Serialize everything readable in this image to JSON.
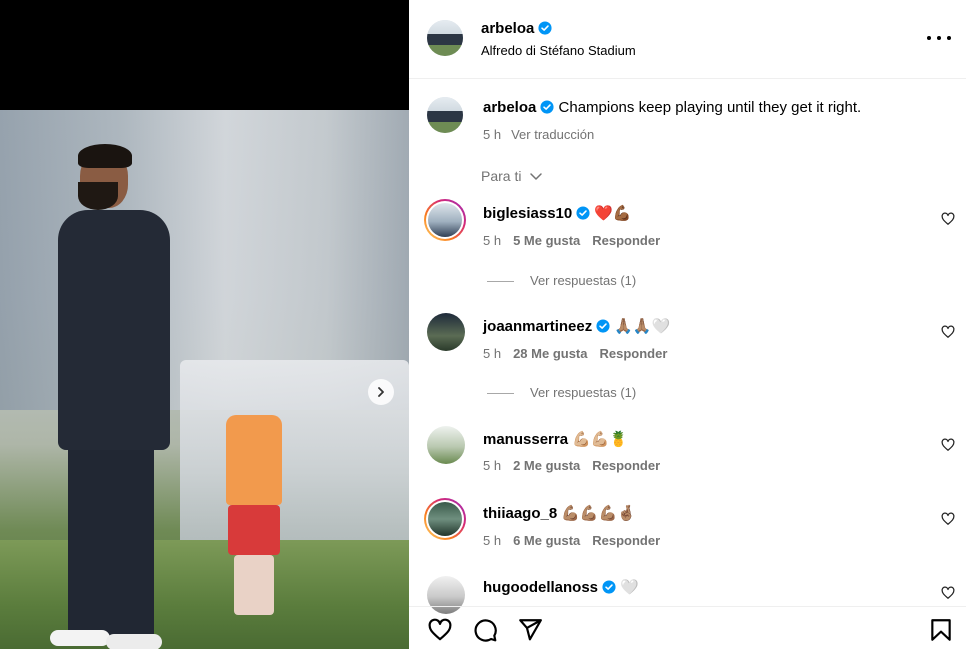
{
  "post": {
    "username": "arbeloa",
    "location": "Alfredo di Stéfano Stadium",
    "caption": "Champions keep playing until they get it right.",
    "time": "5 h",
    "translate": "Ver traducción"
  },
  "sort_label": "Para ti",
  "comments": [
    {
      "username": "biglesiass10",
      "emojis": "❤️💪🏾",
      "time": "5 h",
      "likes": "5 Me gusta",
      "reply": "Responder",
      "view_replies": "Ver respuestas (1)"
    },
    {
      "username": "joaanmartineez",
      "emojis": "🙏🏽🙏🏽🤍",
      "time": "5 h",
      "likes": "28 Me gusta",
      "reply": "Responder",
      "view_replies": "Ver respuestas (1)"
    },
    {
      "username": "manusserra",
      "emojis": "💪🏼💪🏼🍍",
      "time": "5 h",
      "likes": "2 Me gusta",
      "reply": "Responder"
    },
    {
      "username": "thiiaago_8",
      "emojis": "💪🏽💪🏽💪🏽🤞🏽",
      "time": "5 h",
      "likes": "6 Me gusta",
      "reply": "Responder"
    },
    {
      "username": "hugoodellanoss",
      "emojis": "🤍"
    }
  ],
  "colors": {
    "verified": "#0095f6",
    "muted": "#737373"
  },
  "icons": [
    "verified-badge-icon",
    "more-options-icon",
    "chevron-down-icon",
    "heart-icon",
    "comment-icon",
    "share-icon",
    "bookmark-icon",
    "chevron-right-icon"
  ]
}
